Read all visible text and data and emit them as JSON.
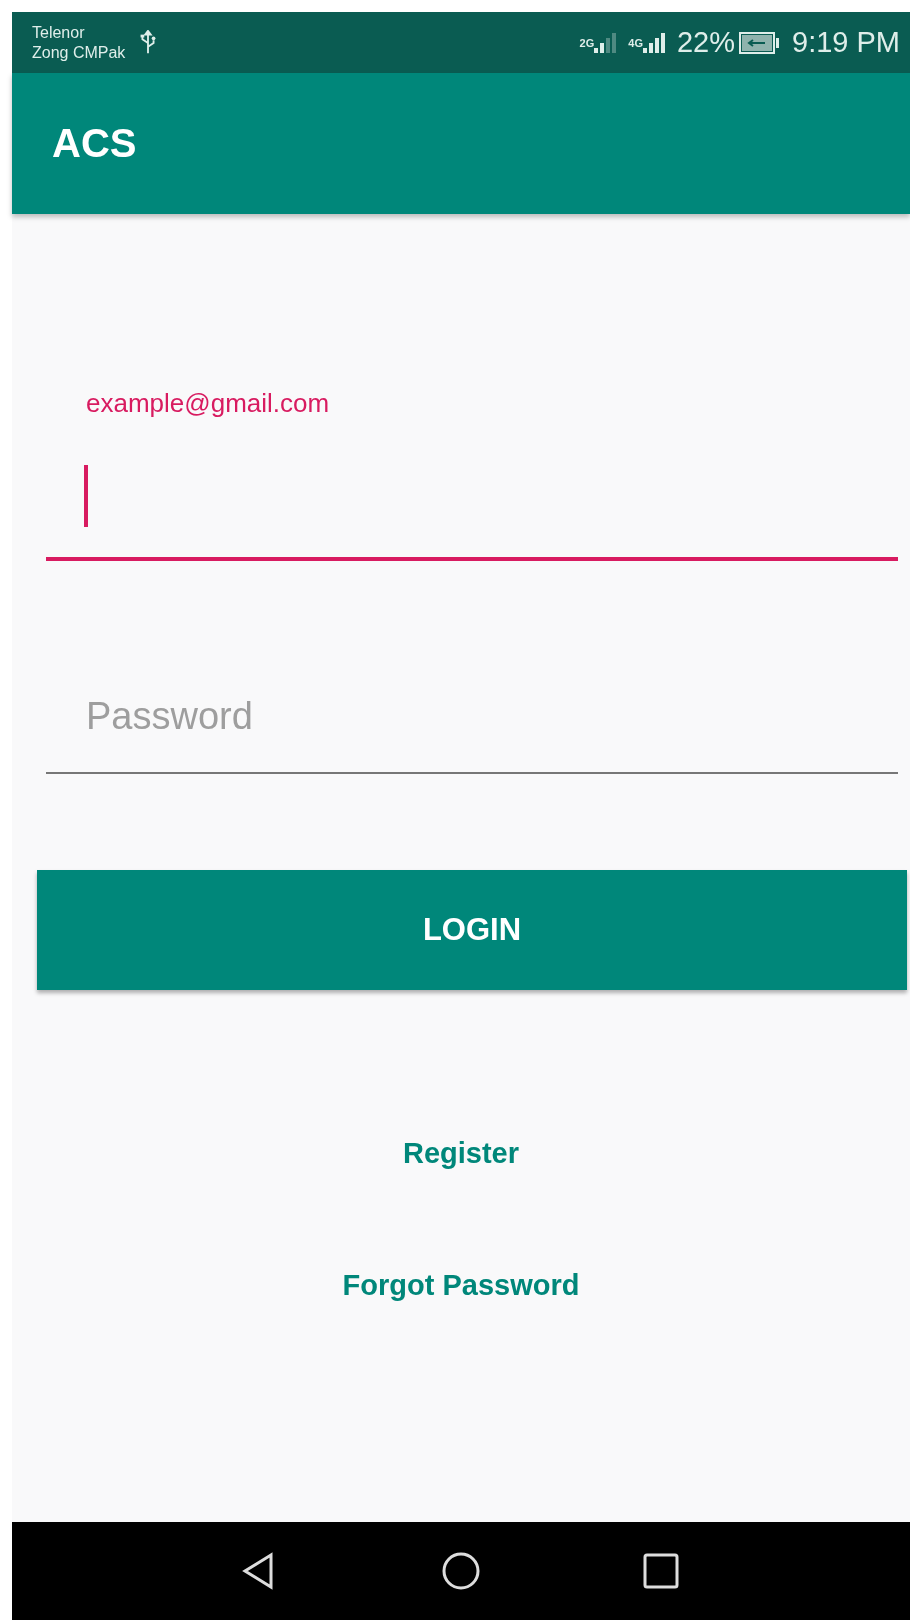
{
  "status_bar": {
    "carriers": [
      "Telenor",
      "Zong CMPak"
    ],
    "networks": [
      "2G",
      "4G"
    ],
    "battery": "22%",
    "charging": true,
    "time": "9:19 PM"
  },
  "app_bar": {
    "title": "ACS"
  },
  "fields": [
    {
      "label": "example@gmail.com",
      "focused": true
    },
    {
      "placeholder": "Password",
      "focused": false
    }
  ],
  "login_button": "LOGIN",
  "links": [
    "Register",
    "Forgot Password"
  ]
}
